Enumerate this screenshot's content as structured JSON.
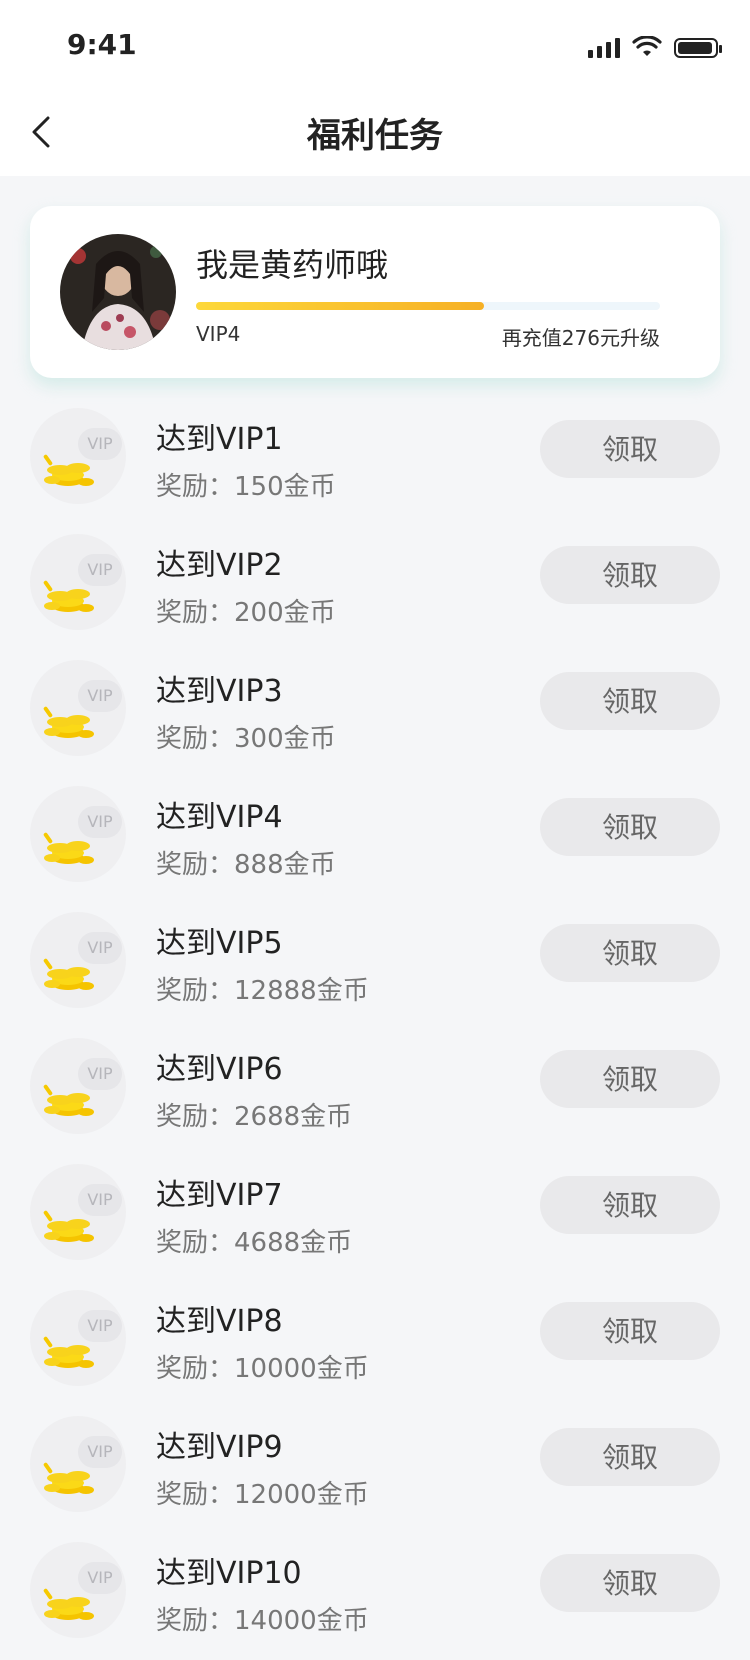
{
  "status_bar": {
    "time": "9:41"
  },
  "header": {
    "title": "福利任务"
  },
  "profile": {
    "name": "我是黄药师哦",
    "vip_level": "VIP4",
    "upgrade_text": "再充值276元升级",
    "progress": 0.62
  },
  "tasks": [
    {
      "title": "达到VIP1",
      "reward": "奖励：150金币",
      "badge": "VIP",
      "button": "领取"
    },
    {
      "title": "达到VIP2",
      "reward": "奖励：200金币",
      "badge": "VIP",
      "button": "领取"
    },
    {
      "title": "达到VIP3",
      "reward": "奖励：300金币",
      "badge": "VIP",
      "button": "领取"
    },
    {
      "title": "达到VIP4",
      "reward": "奖励：888金币",
      "badge": "VIP",
      "button": "领取"
    },
    {
      "title": "达到VIP5",
      "reward": "奖励：12888金币",
      "badge": "VIP",
      "button": "领取"
    },
    {
      "title": "达到VIP6",
      "reward": "奖励：2688金币",
      "badge": "VIP",
      "button": "领取"
    },
    {
      "title": "达到VIP7",
      "reward": "奖励：4688金币",
      "badge": "VIP",
      "button": "领取"
    },
    {
      "title": "达到VIP8",
      "reward": "奖励：10000金币",
      "badge": "VIP",
      "button": "领取"
    },
    {
      "title": "达到VIP9",
      "reward": "奖励：12000金币",
      "badge": "VIP",
      "button": "领取"
    },
    {
      "title": "达到VIP10",
      "reward": "奖励：14000金币",
      "badge": "VIP",
      "button": "领取"
    }
  ],
  "colors": {
    "accent_start": "#fdd83a",
    "accent_end": "#f6b025",
    "coin": "#f8d31c",
    "button_bg": "#e9e9eb"
  },
  "icons": {
    "back": "chevron-left-icon",
    "coins": "coins-icon",
    "signal": "signal-icon",
    "wifi": "wifi-icon",
    "battery": "battery-icon"
  }
}
